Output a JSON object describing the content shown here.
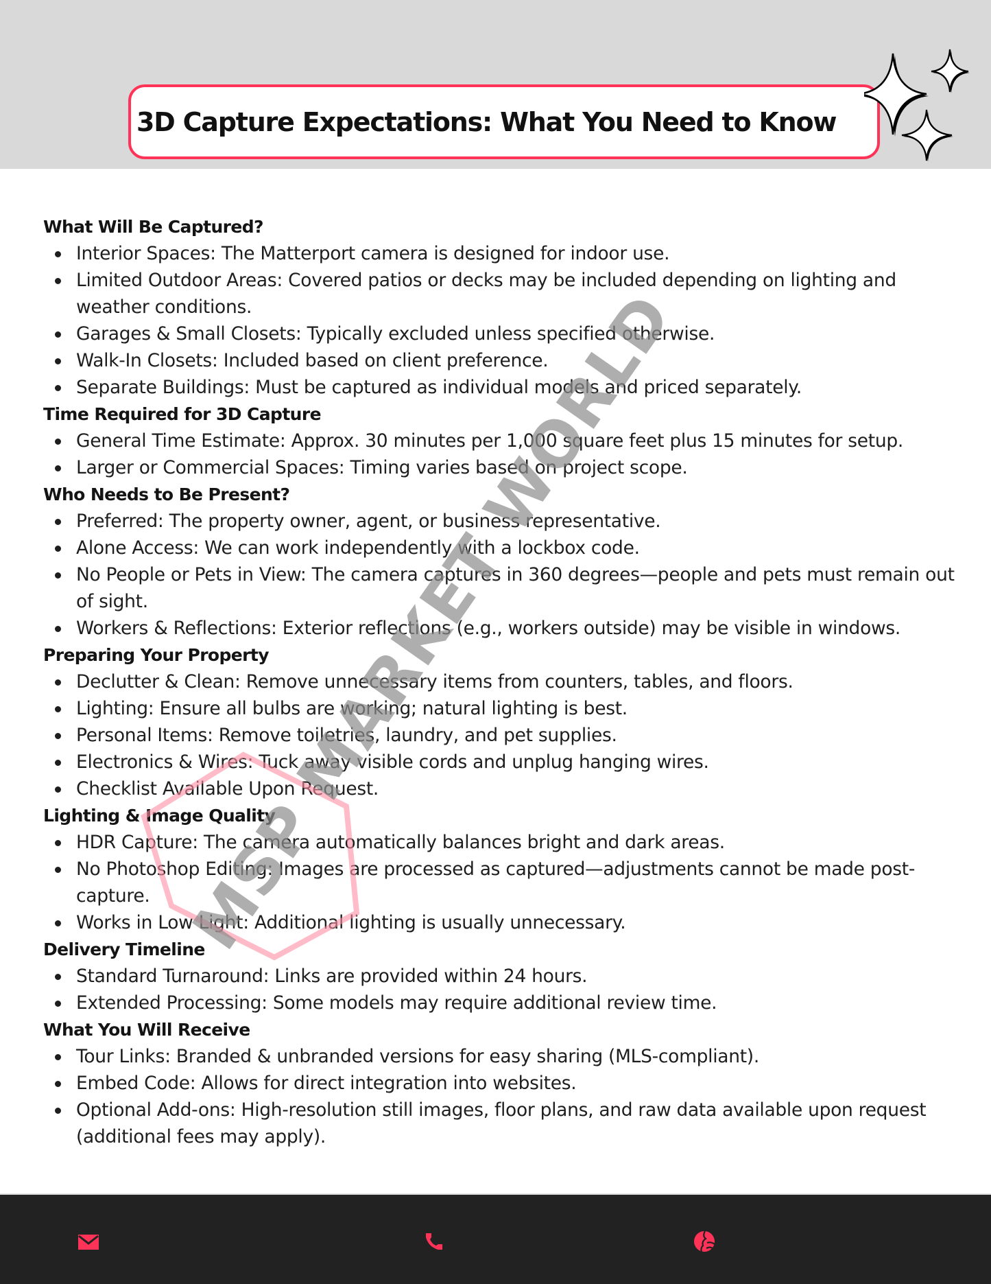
{
  "header": {
    "title": "3D Capture Expectations: What You Need to Know",
    "accent_color": "#ff3358",
    "band_color": "#d9d9d9"
  },
  "sections": [
    {
      "heading": "What Will Be Captured?",
      "items": [
        "Interior Spaces: The Matterport camera is designed for indoor use.",
        "Limited Outdoor Areas: Covered patios or decks may be included depending on lighting and weather conditions.",
        "Garages & Small Closets: Typically excluded unless specified otherwise.",
        "Walk-In Closets: Included based on client preference.",
        "Separate Buildings: Must be captured as individual models and priced separately."
      ]
    },
    {
      "heading": "Time Required for 3D Capture",
      "items": [
        "General Time Estimate: Approx. 30 minutes per 1,000 square feet plus 15 minutes for setup.",
        "Larger or Commercial Spaces: Timing varies based on project scope."
      ]
    },
    {
      "heading": "Who Needs to Be Present?",
      "items": [
        "Preferred: The property owner, agent, or business representative.",
        "Alone Access: We can work independently with a lockbox code.",
        "No People or Pets in View: The camera captures in 360 degrees—people and pets must remain out of sight.",
        "Workers & Reflections: Exterior reflections (e.g., workers outside) may be visible in windows."
      ]
    },
    {
      "heading": "Preparing Your Property",
      "items": [
        "Declutter & Clean: Remove unnecessary items from counters, tables, and floors.",
        "Lighting: Ensure all bulbs are working; natural lighting is best.",
        "Personal Items: Remove toiletries, laundry, and pet supplies.",
        "Electronics & Wires: Tuck away visible cords and unplug hanging wires.",
        "Checklist Available Upon Request."
      ]
    },
    {
      "heading": "Lighting & Image Quality",
      "items": [
        "HDR Capture: The camera automatically balances bright and dark areas.",
        "No Photoshop Editing: Images are processed as captured—adjustments cannot be made post-capture.",
        "Works in Low Light: Additional lighting is usually unnecessary."
      ]
    },
    {
      "heading": "Delivery Timeline",
      "items": [
        "Standard Turnaround: Links are provided within 24 hours.",
        "Extended Processing: Some models may require additional review time."
      ]
    },
    {
      "heading": "What You Will Receive",
      "items": [
        "Tour Links: Branded & unbranded versions for easy sharing (MLS-compliant).",
        "Embed Code: Allows for direct integration into websites.",
        "Optional Add-ons: High-resolution still images, floor plans, and raw data available upon request (additional fees may apply)."
      ]
    }
  ],
  "watermark": {
    "text": "MSP MARKET WORLD",
    "text_color": "#8c8c8c",
    "shape_color": "#ff8fa3"
  },
  "footer": {
    "background": "#222222",
    "icon_color": "#ff3358",
    "icons": [
      "mail-icon",
      "phone-icon",
      "globe-icon"
    ]
  }
}
